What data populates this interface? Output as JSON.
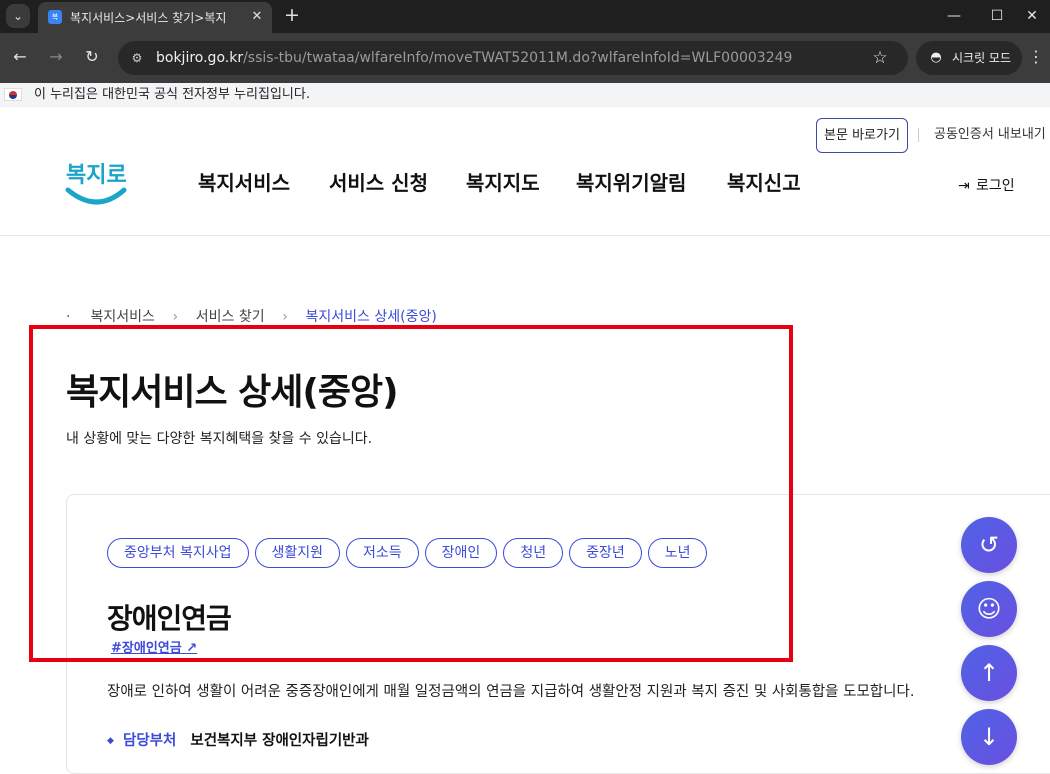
{
  "browser": {
    "tab_title": "복지서비스>서비스 찾기>복지",
    "url_host": "bokjiro.go.kr",
    "url_path": "/ssis-tbu/twataa/wlfareInfo/moveTWAT52011M.do?wlfareInfoId=WLF00003249",
    "incognito_label": "시크릿 모드"
  },
  "gov_banner": {
    "text": "이 누리집은 대한민국 공식 전자정부 누리집입니다."
  },
  "header": {
    "skip_link": "본문 바로가기",
    "cert_link": "공동인증서 내보내기",
    "logo_text": "복지로",
    "nav": [
      "복지서비스",
      "서비스 신청",
      "복지지도",
      "복지위기알림",
      "복지신고"
    ],
    "login": "로그인"
  },
  "breadcrumb": [
    "복지서비스",
    "서비스 찾기",
    "복지서비스 상세(중앙)"
  ],
  "page": {
    "title": "복지서비스 상세(중앙)",
    "description": "내 상황에 맞는 다양한 복지혜택을 찾을 수 있습니다."
  },
  "service": {
    "tags": [
      "중앙부처 복지사업",
      "생활지원",
      "저소득",
      "장애인",
      "청년",
      "중장년",
      "노년"
    ],
    "title": "장애인연금",
    "hashtag": "#장애인연금",
    "description": "장애로 인하여 생활이 어려운 중증장애인에게 매월 일정금액의 연금을 지급하여 생활안정 지원과 복지 증진 및 사회통합을 도모합니다.",
    "dept_label": "담당부처",
    "dept_value": "보건복지부 장애인자립기반과"
  },
  "colors": {
    "accent": "#3b4bd8",
    "highlight": "#e60012"
  },
  "icons": [
    "recent-history-icon",
    "chatbot-icon",
    "scroll-up-icon",
    "scroll-down-icon"
  ]
}
